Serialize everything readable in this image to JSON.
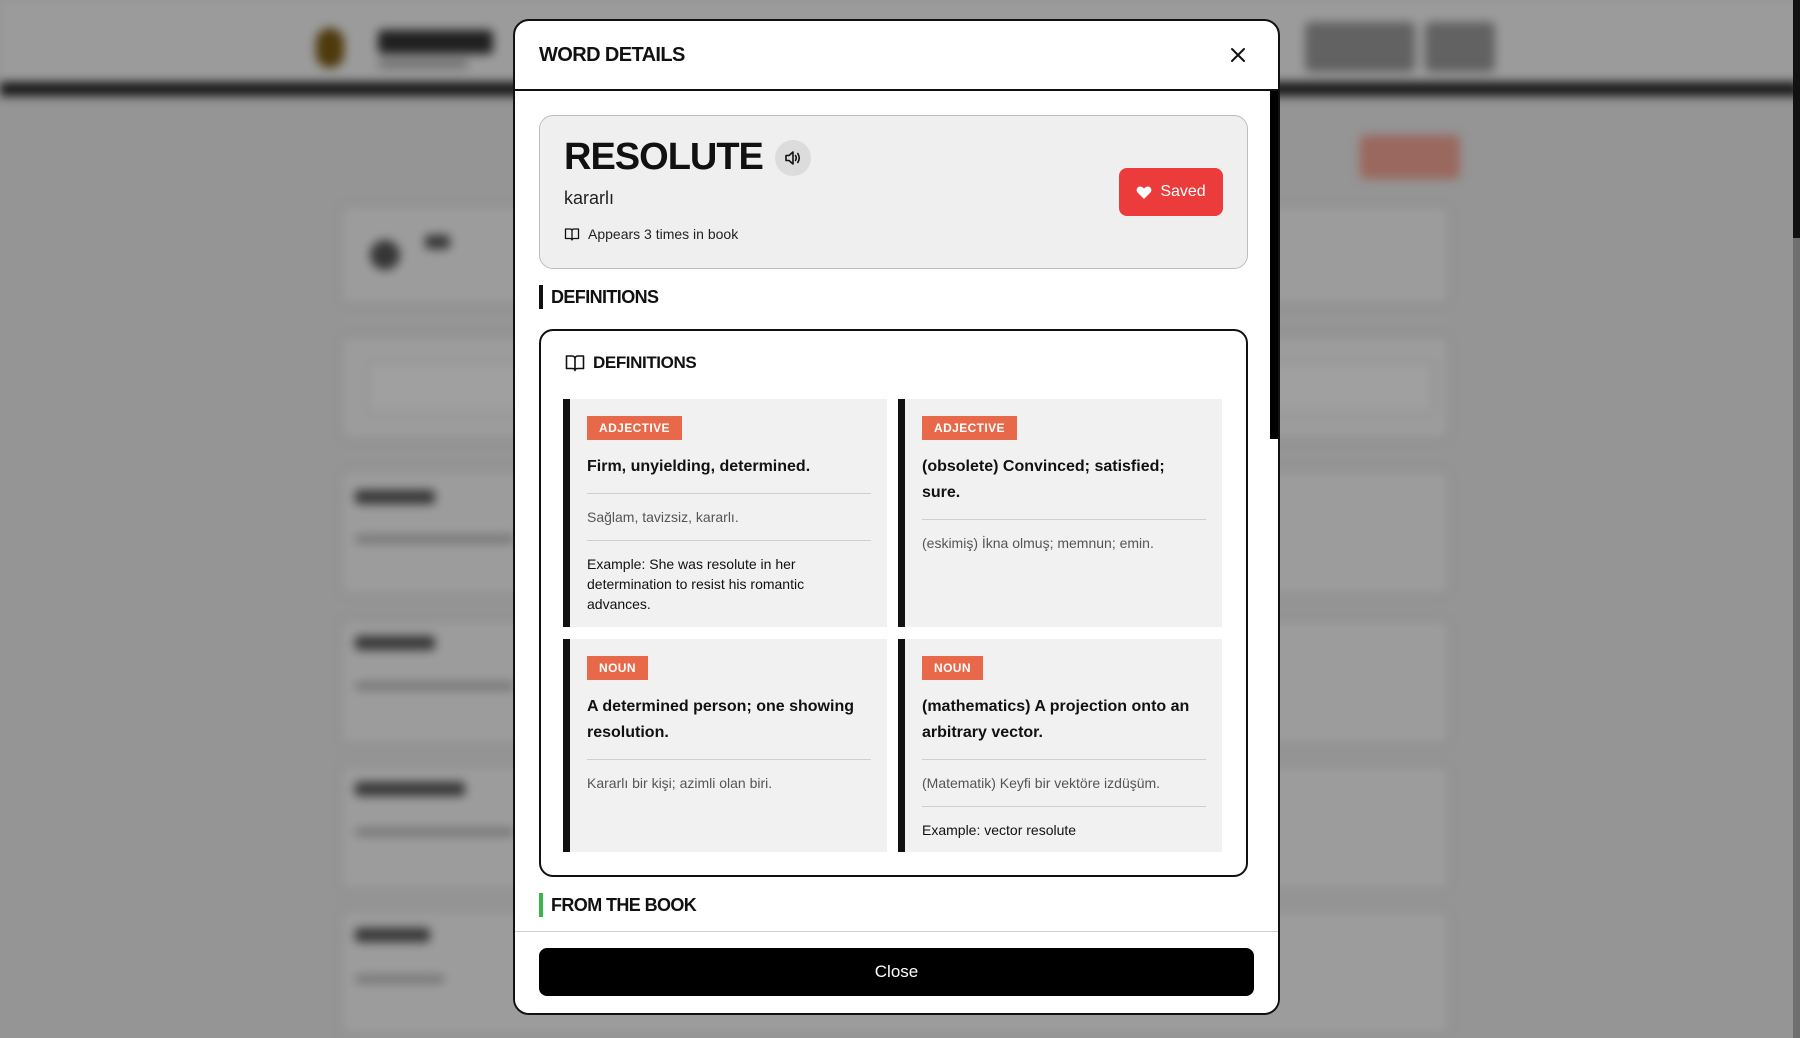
{
  "modal": {
    "title": "WORD DETAILS",
    "close_icon": "close-icon",
    "footer_close_label": "Close"
  },
  "word": {
    "term": "RESOLUTE",
    "translation": "kararlı",
    "appears_text": "Appears 3 times in book",
    "saved_label": "Saved",
    "saved_color": "#ec3b3b"
  },
  "sections": {
    "definitions_heading": "DEFINITIONS",
    "definitions_box_title": "DEFINITIONS",
    "from_book_heading": "FROM THE BOOK",
    "definitions_accent": "#111111",
    "from_book_accent": "#3bb54a"
  },
  "definitions": [
    {
      "pos": "ADJECTIVE",
      "english": "Firm, unyielding, determined.",
      "turkish": "Sağlam, tavizsiz, kararlı.",
      "example_label": "Example:",
      "example": "She was resolute in her determination to resist his romantic advances."
    },
    {
      "pos": "ADJECTIVE",
      "english": "(obsolete) Convinced; satisfied; sure.",
      "turkish": "(eskimiş) İkna olmuş; memnun; emin."
    },
    {
      "pos": "NOUN",
      "english": "A determined person; one showing resolution.",
      "turkish": "Kararlı bir kişi; azimli olan biri."
    },
    {
      "pos": "NOUN",
      "english": "(mathematics) A projection onto an arbitrary vector.",
      "turkish": "(Matematik) Keyfi bir vektöre izdüşüm.",
      "example_label": "Example:",
      "example": "vector resolute"
    }
  ],
  "colors": {
    "badge": "#e8684a",
    "card_bg": "#f1f1f1"
  }
}
